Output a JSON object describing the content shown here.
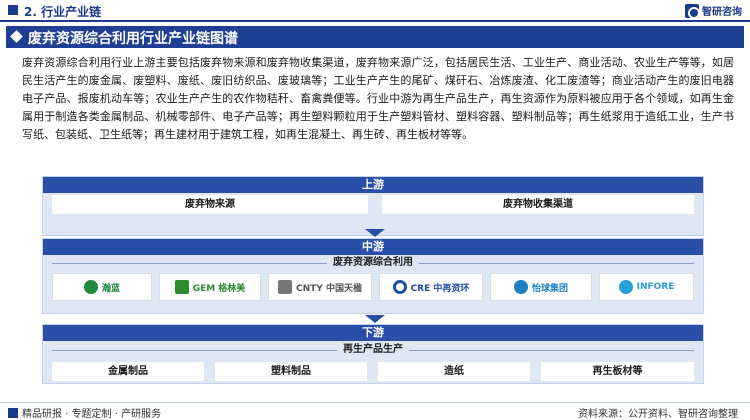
{
  "header": {
    "section_title": "2. 行业产业链",
    "brand": "智研咨询"
  },
  "banner": {
    "title": "废弃资源综合利用行业产业链图谱"
  },
  "paragraph": "废弃资源综合利用行业上游主要包括废弃物来源和废弃物收集渠道，废弃物来源广泛，包括居民生活、工业生产、商业活动、农业生产等等，如居民生活产生的废金属、废塑料、废纸、废旧纺织品、废玻璃等；工业生产产生的尾矿、煤矸石、冶炼废渣、化工废渣等；商业活动产生的废旧电器电子产品、报废机动车等；农业生产产生的农作物秸秆、畜禽粪便等。行业中游为再生产品生产，再生资源作为原料被应用于各个领域，如再生金属用于制造各类金属制品、机械零部件、电子产品等；再生塑料颗粒用于生产塑料管材、塑料容器、塑料制品等；再生纸浆用于造纸工业，生产书写纸、包装纸、卫生纸等；再生建材用于建筑工程，如再生混凝土、再生砖、再生板材等等。",
  "upstream": {
    "label": "上游",
    "items": [
      "废弃物来源",
      "废弃物收集渠道"
    ]
  },
  "midstream": {
    "label": "中游",
    "subtitle": "废弃资源综合利用",
    "companies": [
      {
        "name": "瀚蓝",
        "color": "#1f8a3b"
      },
      {
        "name": "GEM 格林美",
        "color": "#2e8b2e"
      },
      {
        "name": "CNTY 中国天楹",
        "color": "#555555"
      },
      {
        "name": "CRE 中再资环",
        "color": "#1e4fa0"
      },
      {
        "name": "怡球集团",
        "color": "#1a7fc0"
      },
      {
        "name": "INFORE",
        "color": "#2aa0d8"
      }
    ]
  },
  "downstream": {
    "label": "下游",
    "subtitle": "再生产品生产",
    "items": [
      "金属制品",
      "塑料制品",
      "造纸",
      "再生板材等"
    ]
  },
  "footer": {
    "left": "精品研报 · 专题定制 · 产研服务",
    "source": "资料来源：公开资料、智研咨询整理"
  }
}
